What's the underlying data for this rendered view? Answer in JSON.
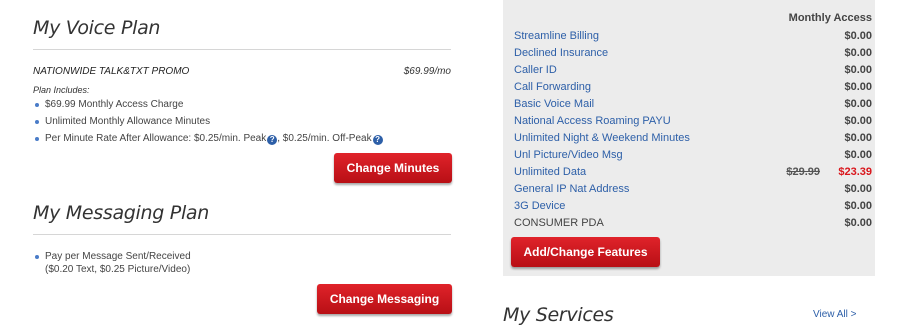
{
  "voice_plan": {
    "title": "My Voice Plan",
    "plan_name": "NATIONWIDE TALK&TXT PROMO",
    "plan_price": "$69.99/mo",
    "plan_includes": "Plan Includes:",
    "bullets": [
      "$69.99 Monthly Access Charge",
      "Unlimited Monthly Allowance Minutes"
    ],
    "rate_prefix": "Per Minute Rate After Allowance: $0.25/min.",
    "rate_peak": "Peak",
    "rate_offpeak_price": ", $0.25/min.",
    "rate_offpeak": "Off-Peak",
    "help_glyph": "?",
    "change_button": "Change Minutes"
  },
  "messaging_plan": {
    "title": "My Messaging Plan",
    "bullet_line1": "Pay per Message Sent/Received",
    "bullet_line2": "($0.20 Text, $0.25 Picture/Video)",
    "change_button": "Change Messaging"
  },
  "features": {
    "header": "Monthly Access",
    "items": [
      {
        "name": "Streamline Billing",
        "price": "$0.00"
      },
      {
        "name": "Declined Insurance",
        "price": "$0.00"
      },
      {
        "name": "Caller ID",
        "price": "$0.00"
      },
      {
        "name": "Call Forwarding",
        "price": "$0.00"
      },
      {
        "name": "Basic Voice Mail",
        "price": "$0.00"
      },
      {
        "name": "National Access Roaming PAYU",
        "price": "$0.00"
      },
      {
        "name": "Unlimited Night & Weekend Minutes",
        "price": "$0.00"
      },
      {
        "name": "Unl Picture/Video Msg",
        "price": "$0.00"
      },
      {
        "name": "Unlimited Data",
        "old_price": "$29.99",
        "price": "$23.39"
      },
      {
        "name": "General IP Nat Address",
        "price": "$0.00"
      },
      {
        "name": "3G Device",
        "price": "$0.00"
      },
      {
        "name": "CONSUMER PDA",
        "price": "$0.00"
      }
    ],
    "button": "Add/Change Features"
  },
  "services": {
    "title": "My Services",
    "view_all": "View All >"
  },
  "colors": {
    "accent_red": "#d9161c",
    "link_blue": "#2d5fa8",
    "panel_bg": "#ececec"
  }
}
